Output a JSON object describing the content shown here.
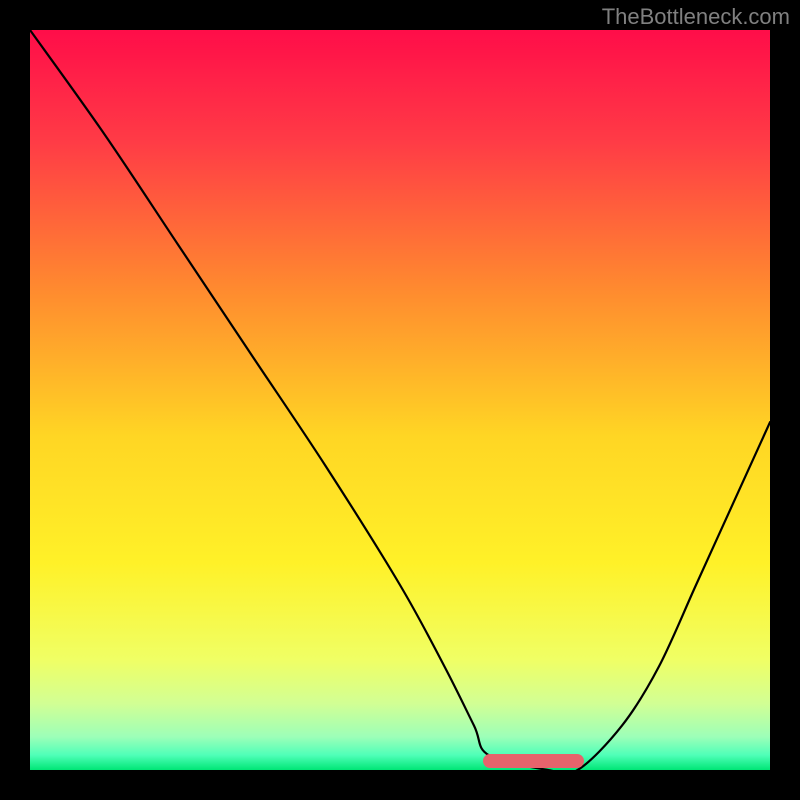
{
  "watermark": "TheBottleneck.com",
  "chart_data": {
    "type": "line",
    "title": "",
    "xlabel": "",
    "ylabel": "",
    "xlim": [
      0,
      100
    ],
    "ylim": [
      0,
      100
    ],
    "grid": false,
    "legend": false,
    "series": [
      {
        "name": "bottleneck-curve",
        "x": [
          0,
          10,
          20,
          30,
          40,
          50,
          56,
          60,
          62,
          70,
          74,
          80,
          85,
          90,
          95,
          100
        ],
        "values": [
          100,
          86,
          71,
          56,
          41,
          25,
          14,
          6,
          2,
          0,
          0,
          6,
          14,
          25,
          36,
          47
        ]
      }
    ],
    "flat_region": {
      "x_start": 62,
      "x_end": 74,
      "y": 0
    },
    "background_gradient": [
      {
        "pos": 0.0,
        "color": "#ff0d49"
      },
      {
        "pos": 0.15,
        "color": "#ff3b46"
      },
      {
        "pos": 0.35,
        "color": "#ff8a2f"
      },
      {
        "pos": 0.55,
        "color": "#ffd624"
      },
      {
        "pos": 0.72,
        "color": "#fff128"
      },
      {
        "pos": 0.85,
        "color": "#f0ff64"
      },
      {
        "pos": 0.91,
        "color": "#d2ff94"
      },
      {
        "pos": 0.955,
        "color": "#9dffb8"
      },
      {
        "pos": 0.98,
        "color": "#4fffb8"
      },
      {
        "pos": 1.0,
        "color": "#00e676"
      }
    ],
    "marker_color": "#e6636c"
  }
}
